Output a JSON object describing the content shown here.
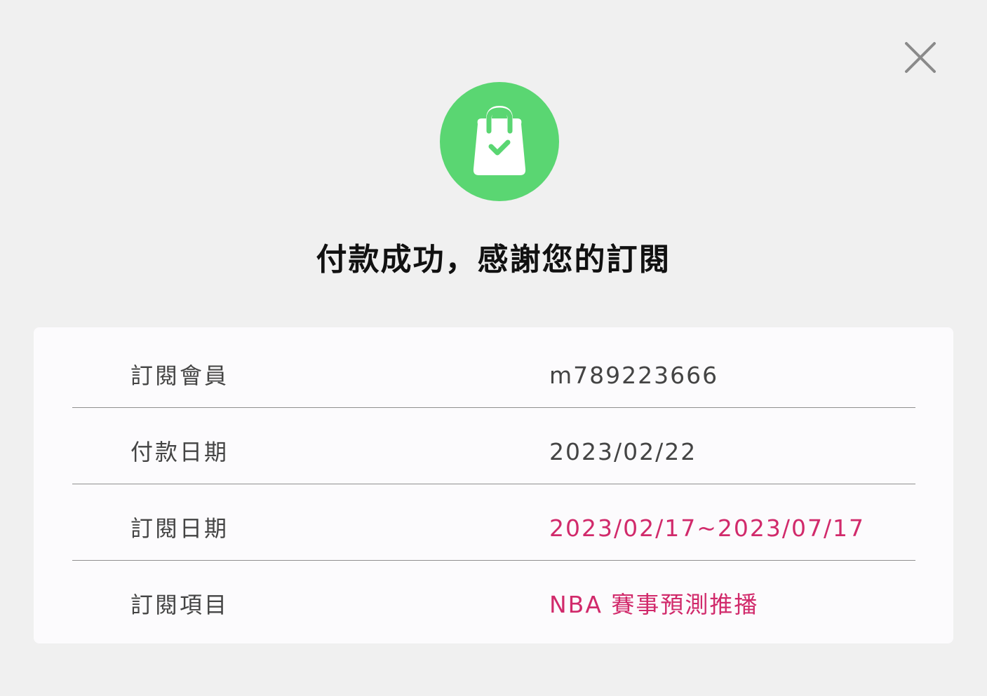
{
  "dialog": {
    "close_icon": "close-icon",
    "success_icon": "shopping-bag-check-icon",
    "title": "付款成功，感謝您的訂閱"
  },
  "colors": {
    "background": "#f0f0f0",
    "card": "#fcfbfd",
    "success_green": "#5ad672",
    "accent": "#d12a6b",
    "text": "#444444"
  },
  "details": [
    {
      "label": "訂閱會員",
      "value": "m789223666"
    },
    {
      "label": "付款日期",
      "value": "2023/02/22"
    },
    {
      "label": "訂閱日期",
      "value": "2023/02/17~2023/07/17"
    },
    {
      "label": "訂閱項目",
      "value": "NBA 賽事預測推播"
    }
  ]
}
